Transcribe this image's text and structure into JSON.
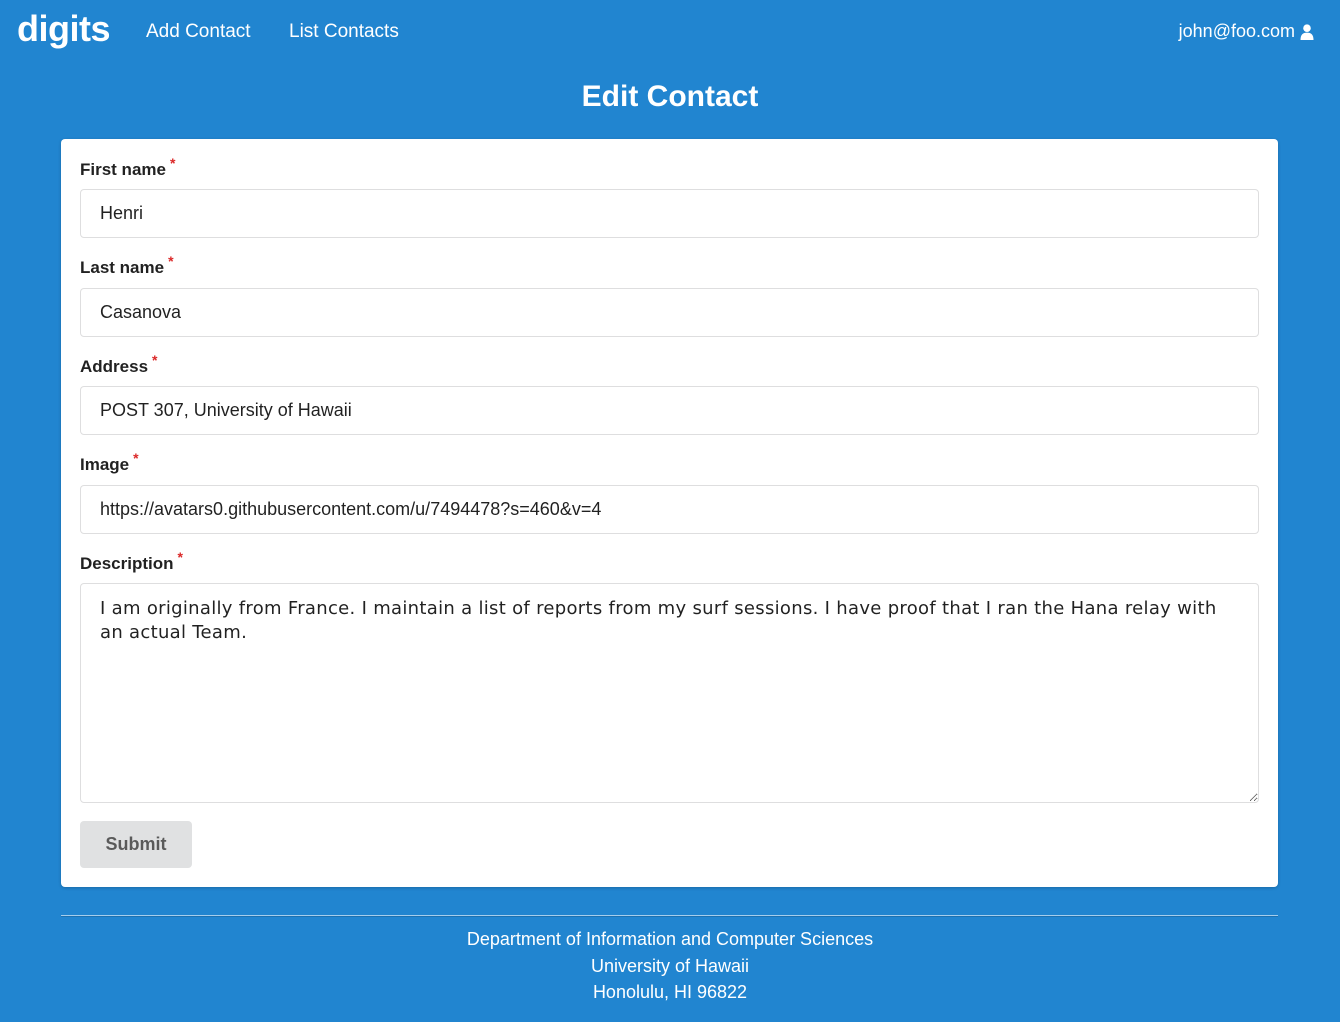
{
  "navbar": {
    "brand": "digits",
    "links": [
      "Add Contact",
      "List Contacts"
    ],
    "user_email": "john@foo.com",
    "user_icon": "user-icon"
  },
  "page": {
    "title": "Edit Contact"
  },
  "form": {
    "required_marker": "*",
    "first_name": {
      "label": "First name",
      "value": "Henri"
    },
    "last_name": {
      "label": "Last name",
      "value": "Casanova"
    },
    "address": {
      "label": "Address",
      "value": "POST 307, University of Hawaii"
    },
    "image": {
      "label": "Image",
      "value": "https://avatars0.githubusercontent.com/u/7494478?s=460&v=4"
    },
    "description": {
      "label": "Description",
      "value": "I am originally from France. I maintain a list of reports from my surf sessions. I have proof that I ran the Hana relay with an actual Team."
    },
    "submit_label": "Submit"
  },
  "footer": {
    "line1": "Department of Information and Computer Sciences",
    "line2": "University of Hawaii",
    "line3": "Honolulu, HI 96822"
  },
  "colors": {
    "background": "#2185d0",
    "card": "#ffffff",
    "required": "#db2828",
    "submit_bg": "#e0e1e2"
  }
}
